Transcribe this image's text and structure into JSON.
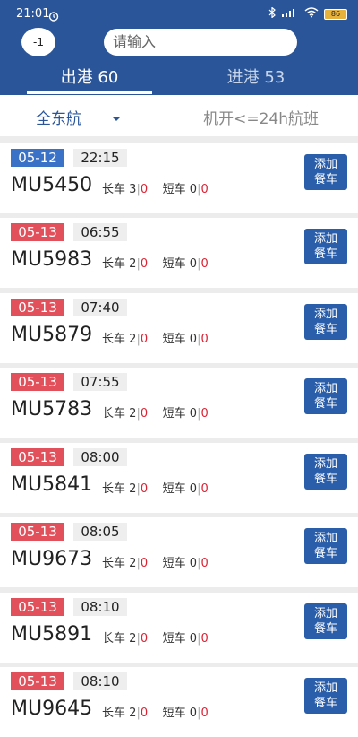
{
  "status": {
    "time": "21:01",
    "battery": "86"
  },
  "header": {
    "circle_button": "-1",
    "search_placeholder": "请输入"
  },
  "tabs": [
    {
      "label": "出港 60"
    },
    {
      "label": "进港 53"
    }
  ],
  "filter": {
    "airline": "全东航",
    "time_filter": "机开<=24h航班"
  },
  "add_label_1": "添加",
  "add_label_2": "餐车",
  "labels": {
    "long": "长车",
    "short": "短车"
  },
  "flights": [
    {
      "date": "05-12",
      "date_color": "#3a72c8",
      "time": "22:15",
      "code": "MU5450",
      "long_total": "3",
      "long_done": "0",
      "short_total": "0",
      "short_done": "0"
    },
    {
      "date": "05-13",
      "date_color": "#e2505b",
      "time": "06:55",
      "code": "MU5983",
      "long_total": "2",
      "long_done": "0",
      "short_total": "0",
      "short_done": "0"
    },
    {
      "date": "05-13",
      "date_color": "#e2505b",
      "time": "07:40",
      "code": "MU5879",
      "long_total": "2",
      "long_done": "0",
      "short_total": "0",
      "short_done": "0"
    },
    {
      "date": "05-13",
      "date_color": "#e2505b",
      "time": "07:55",
      "code": "MU5783",
      "long_total": "2",
      "long_done": "0",
      "short_total": "0",
      "short_done": "0"
    },
    {
      "date": "05-13",
      "date_color": "#e2505b",
      "time": "08:00",
      "code": "MU5841",
      "long_total": "2",
      "long_done": "0",
      "short_total": "0",
      "short_done": "0"
    },
    {
      "date": "05-13",
      "date_color": "#e2505b",
      "time": "08:05",
      "code": "MU9673",
      "long_total": "2",
      "long_done": "0",
      "short_total": "0",
      "short_done": "0"
    },
    {
      "date": "05-13",
      "date_color": "#e2505b",
      "time": "08:10",
      "code": "MU5891",
      "long_total": "2",
      "long_done": "0",
      "short_total": "0",
      "short_done": "0"
    },
    {
      "date": "05-13",
      "date_color": "#e2505b",
      "time": "08:10",
      "code": "MU9645",
      "long_total": "2",
      "long_done": "0",
      "short_total": "0",
      "short_done": "0"
    }
  ]
}
